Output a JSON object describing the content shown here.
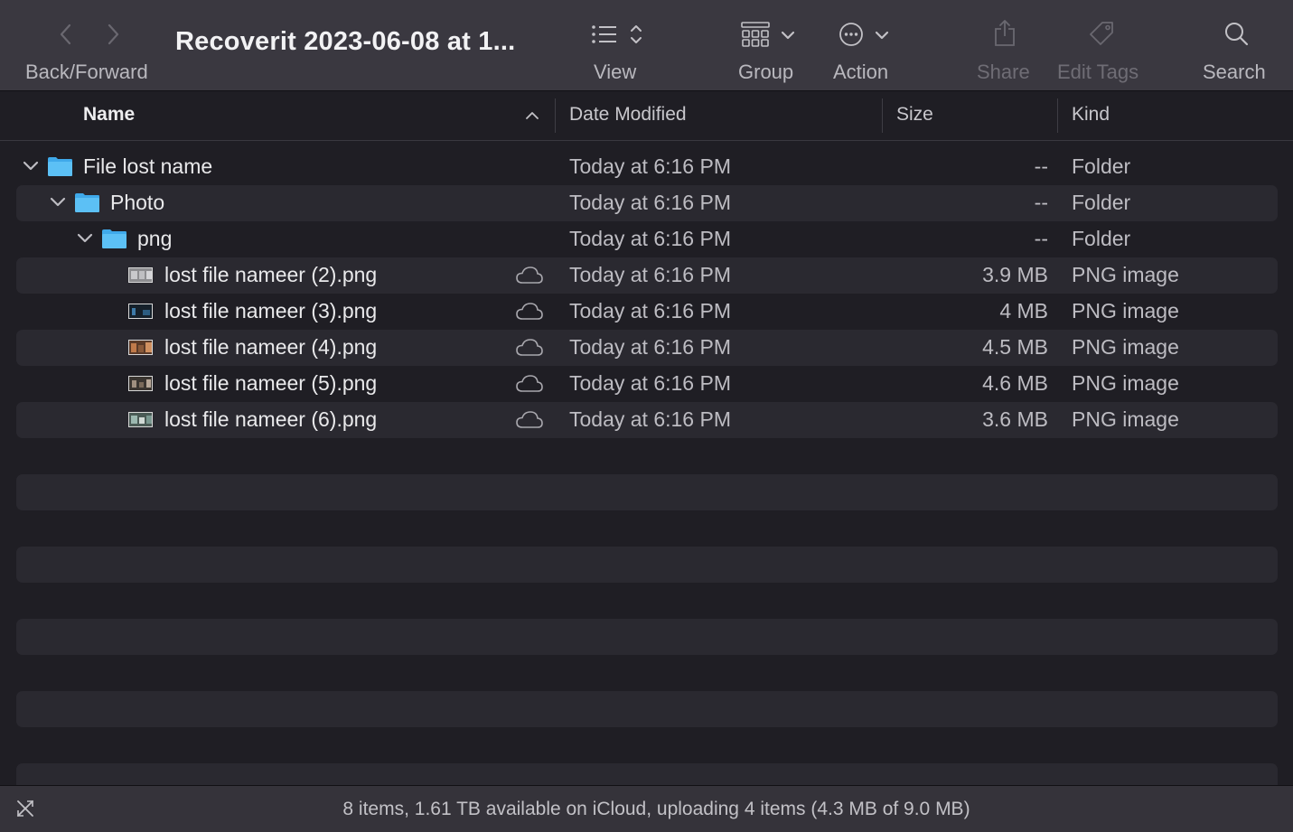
{
  "toolbar": {
    "back_forward_label": "Back/Forward",
    "title": "Recoverit 2023-06-08 at 1...",
    "view_label": "View",
    "group_label": "Group",
    "action_label": "Action",
    "share_label": "Share",
    "edit_tags_label": "Edit Tags",
    "search_label": "Search"
  },
  "columns": {
    "name": "Name",
    "date_modified": "Date Modified",
    "size": "Size",
    "kind": "Kind"
  },
  "rows": [
    {
      "name": "File lost name",
      "date": "Today at 6:16 PM",
      "size": "--",
      "kind": "Folder"
    },
    {
      "name": "Photo",
      "date": "Today at 6:16 PM",
      "size": "--",
      "kind": "Folder"
    },
    {
      "name": "png",
      "date": "Today at 6:16 PM",
      "size": "--",
      "kind": "Folder"
    },
    {
      "name": "lost file nameer (2).png",
      "date": "Today at 6:16 PM",
      "size": "3.9 MB",
      "kind": "PNG image"
    },
    {
      "name": "lost file nameer (3).png",
      "date": "Today at 6:16 PM",
      "size": "4 MB",
      "kind": "PNG image"
    },
    {
      "name": "lost file nameer (4).png",
      "date": "Today at 6:16 PM",
      "size": "4.5 MB",
      "kind": "PNG image"
    },
    {
      "name": "lost file nameer (5).png",
      "date": "Today at 6:16 PM",
      "size": "4.6 MB",
      "kind": "PNG image"
    },
    {
      "name": "lost file nameer (6).png",
      "date": "Today at 6:16 PM",
      "size": "3.6 MB",
      "kind": "PNG image"
    }
  ],
  "status": {
    "text": "8 items, 1.61 TB available on iCloud, uploading 4 items (4.3 MB of 9.0 MB)"
  },
  "colors": {
    "folder_blue": "#4fb3f0",
    "window_bg": "#1f1e24",
    "toolbar_bg": "#3a3840",
    "stripe": "#2a2930"
  }
}
